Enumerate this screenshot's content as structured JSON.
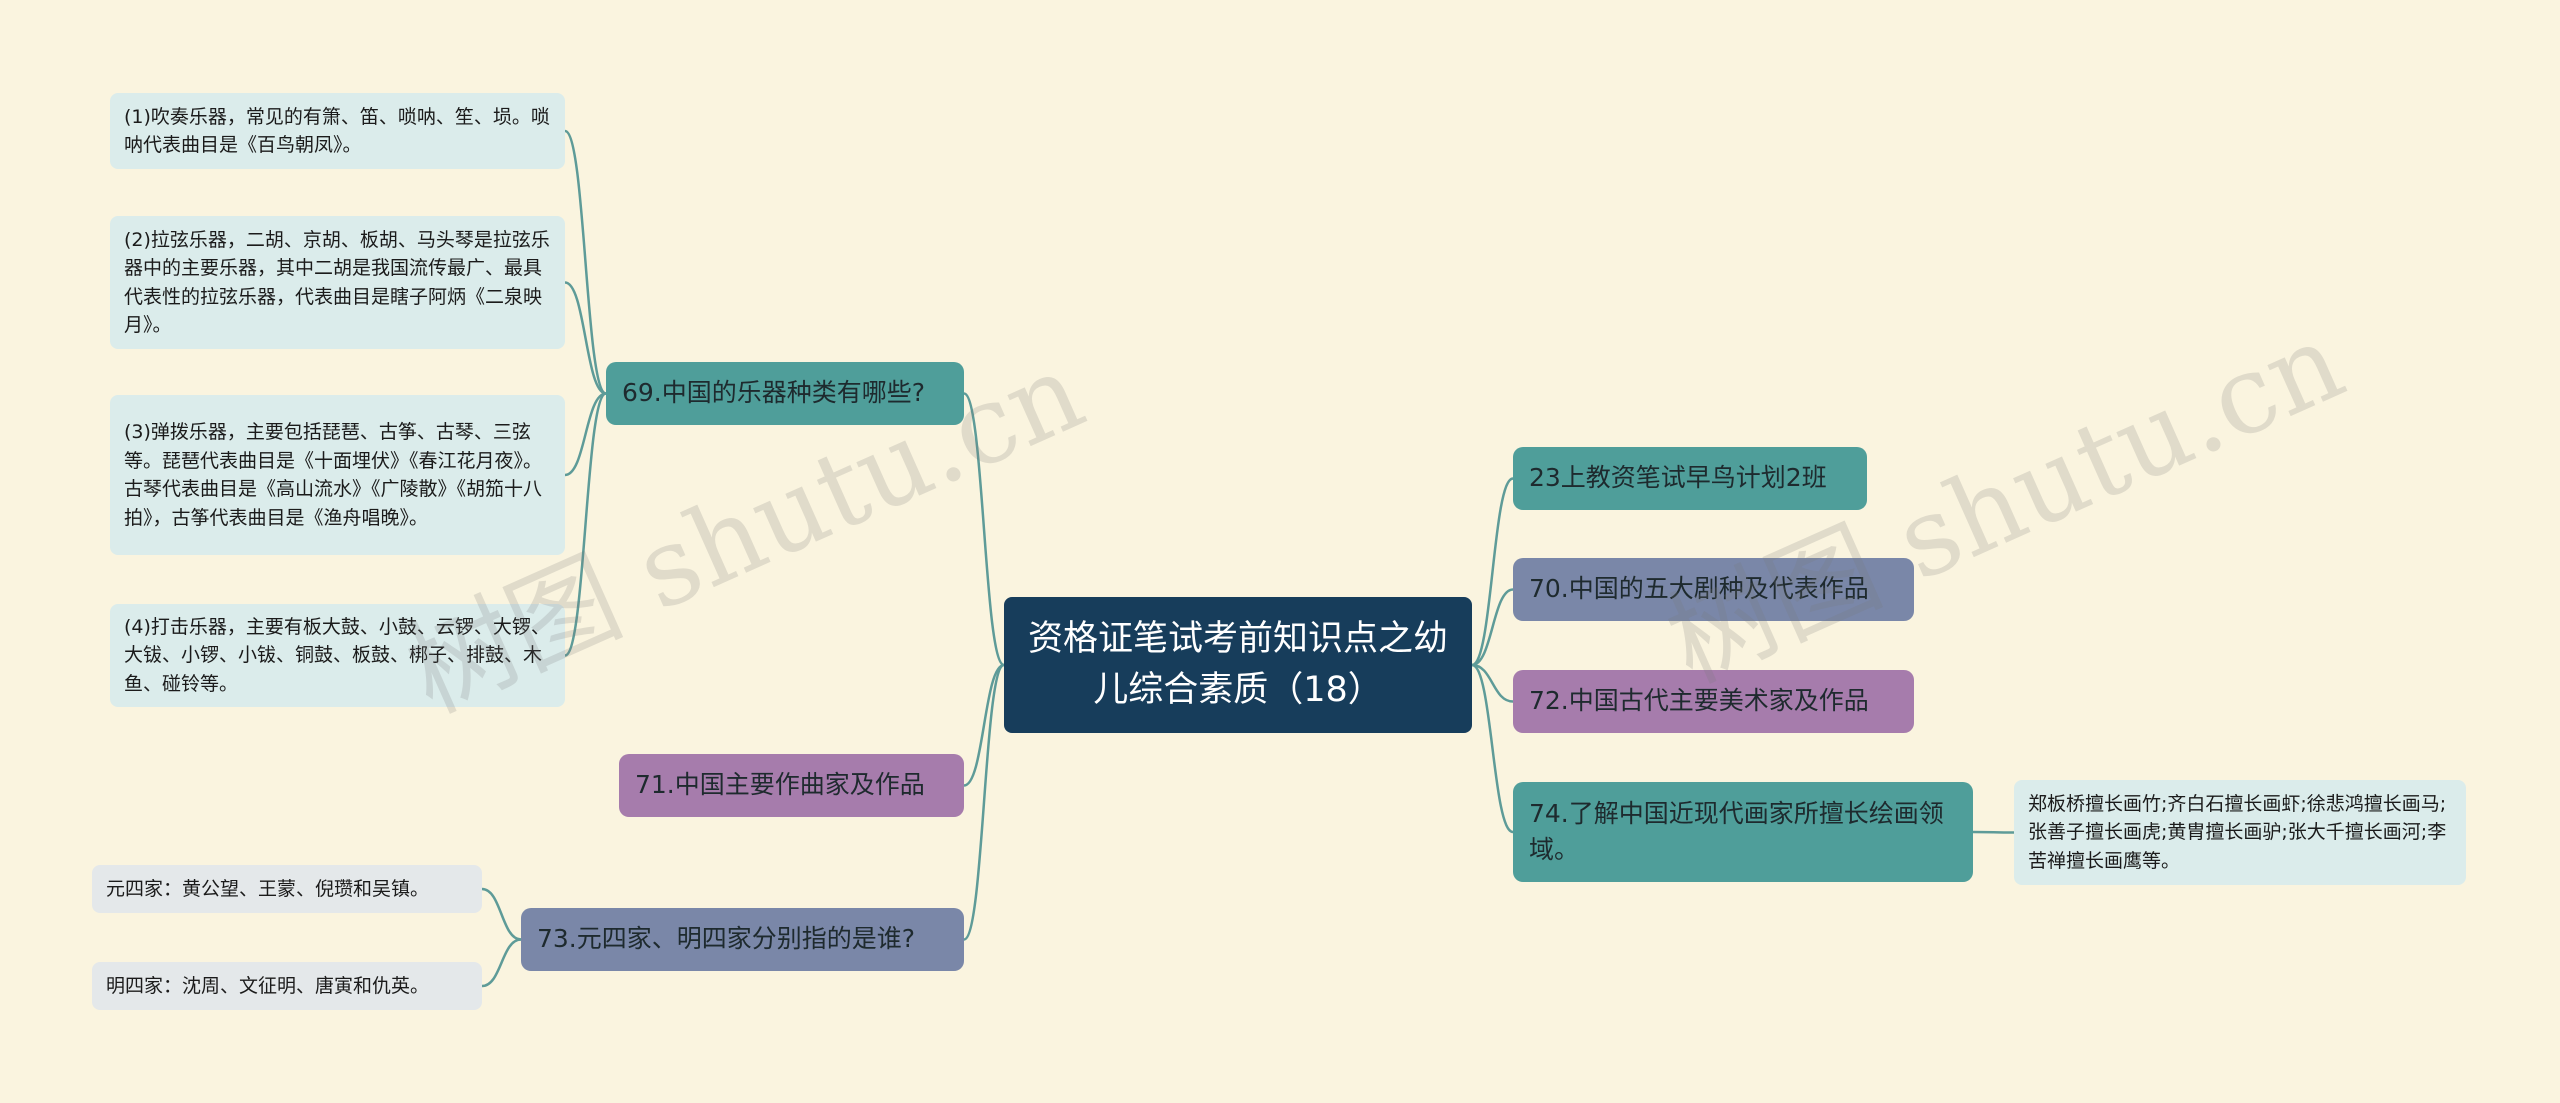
{
  "root": {
    "label": "资格证笔试考前知识点之幼儿综合素质（18）"
  },
  "left": [
    {
      "label": "69.中国的乐器种类有哪些?",
      "children": [
        "(1)吹奏乐器，常见的有箫、笛、唢呐、笙、埙。唢呐代表曲目是《百鸟朝凤》。",
        "(2)拉弦乐器，二胡、京胡、板胡、马头琴是拉弦乐器中的主要乐器，其中二胡是我国流传最广、最具代表性的拉弦乐器，代表曲目是瞎子阿炳《二泉映月》。",
        "(3)弹拨乐器，主要包括琵琶、古筝、古琴、三弦等。琵琶代表曲目是《十面埋伏》《春江花月夜》。古琴代表曲目是《高山流水》《广陵散》《胡笳十八拍》，古筝代表曲目是《渔舟唱晚》。",
        "(4)打击乐器，主要有板大鼓、小鼓、云锣、大锣、大钹、小锣、小钹、铜鼓、板鼓、梆子、排鼓、木鱼、碰铃等。"
      ]
    },
    {
      "label": "71.中国主要作曲家及作品",
      "children": []
    },
    {
      "label": "73.元四家、明四家分别指的是谁?",
      "children": [
        "元四家：黄公望、王蒙、倪瓒和吴镇。",
        "明四家：沈周、文征明、唐寅和仇英。"
      ]
    }
  ],
  "right": [
    {
      "label": "23上教资笔试早鸟计划2班",
      "children": []
    },
    {
      "label": "70.中国的五大剧种及代表作品",
      "children": []
    },
    {
      "label": "72.中国古代主要美术家及作品",
      "children": []
    },
    {
      "label": "74.了解中国近现代画家所擅长绘画领域。",
      "children": [
        "郑板桥擅长画竹;齐白石擅长画虾;徐悲鸿擅长画马;张善子擅长画虎;黄胄擅长画驴;张大千擅长画河;李苦禅擅长画鹰等。"
      ]
    }
  ],
  "watermark": "树图 shutu.cn",
  "colors": {
    "background": "#faf4df",
    "root": "#173d5b",
    "line": "#5e9b98",
    "teal": "#4f9e9a",
    "slate": "#7a87a8",
    "purple": "#a67cac",
    "leaf": "#dbeceb"
  }
}
